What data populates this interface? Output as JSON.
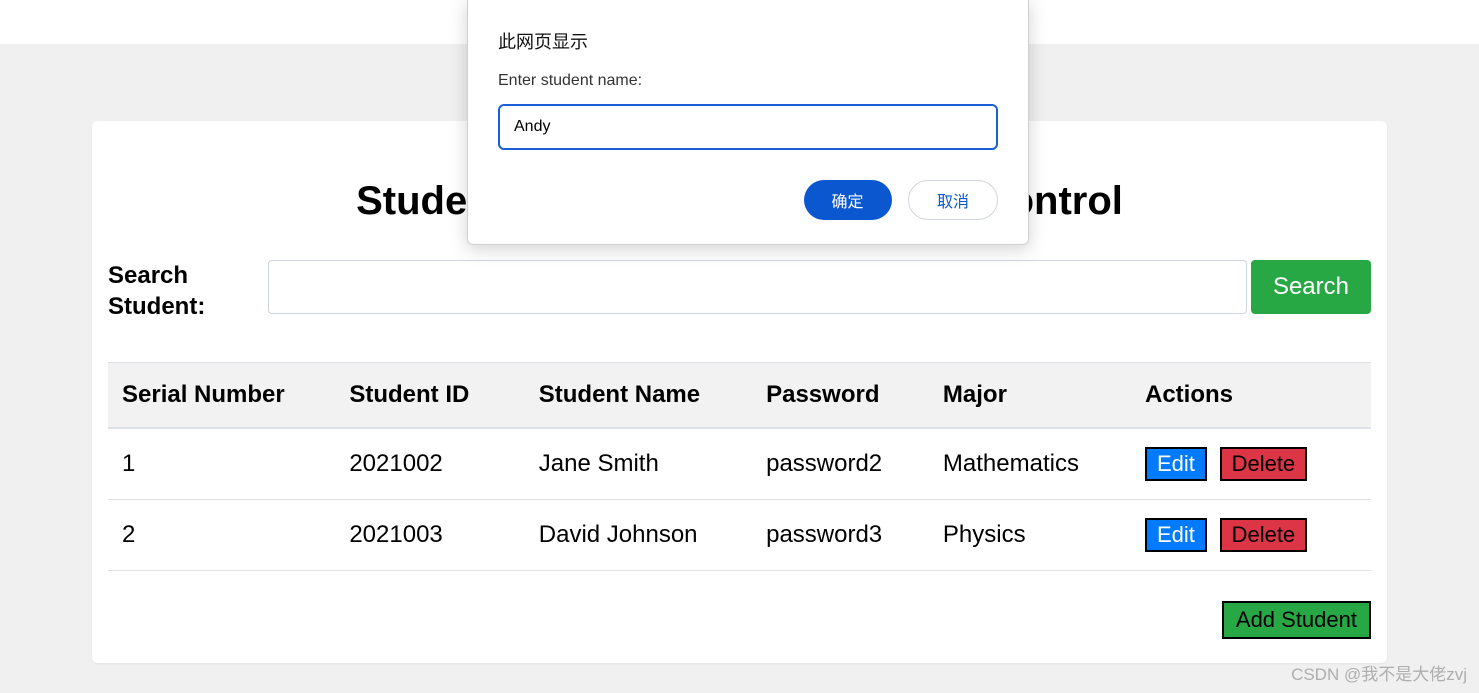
{
  "page": {
    "title_prefix": "Student",
    "title_suffix": "Control"
  },
  "search": {
    "label": "Search Student:",
    "value": "",
    "button": "Search"
  },
  "table": {
    "headers": {
      "serial": "Serial Number",
      "student_id": "Student ID",
      "student_name": "Student Name",
      "password": "Password",
      "major": "Major",
      "actions": "Actions"
    },
    "rows": [
      {
        "serial": "1",
        "student_id": "2021002",
        "student_name": "Jane Smith",
        "password": "password2",
        "major": "Mathematics"
      },
      {
        "serial": "2",
        "student_id": "2021003",
        "student_name": "David Johnson",
        "password": "password3",
        "major": "Physics"
      }
    ],
    "row_actions": {
      "edit": "Edit",
      "delete": "Delete"
    }
  },
  "add_button": "Add Student",
  "modal": {
    "header": "此网页显示",
    "prompt": "Enter student name:",
    "input_value": "Andy",
    "ok": "确定",
    "cancel": "取消"
  },
  "watermark": "CSDN @我不是大佬zvj"
}
